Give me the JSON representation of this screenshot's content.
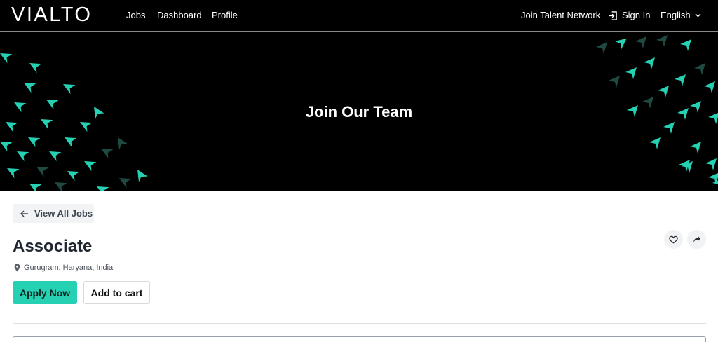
{
  "header": {
    "logo": "VIALTO",
    "nav": [
      "Jobs",
      "Dashboard",
      "Profile"
    ],
    "join_talent": "Join Talent Network",
    "sign_in": "Sign In",
    "language": "English"
  },
  "hero": {
    "title": "Join Our Team"
  },
  "job": {
    "back_label": "View All Jobs",
    "title": "Associate",
    "location": "Gurugram, Haryana, India",
    "apply_label": "Apply Now",
    "cart_label": "Add to cart"
  },
  "colors": {
    "accent": "#26d0b2",
    "dark_accent": "#1e4a42",
    "background": "#000000"
  },
  "icons": {
    "signin": "sign-in-icon",
    "language": "chevron-down-icon",
    "back": "arrow-left-icon",
    "location": "map-pin-icon",
    "favorite": "heart-icon",
    "share": "share-icon"
  }
}
